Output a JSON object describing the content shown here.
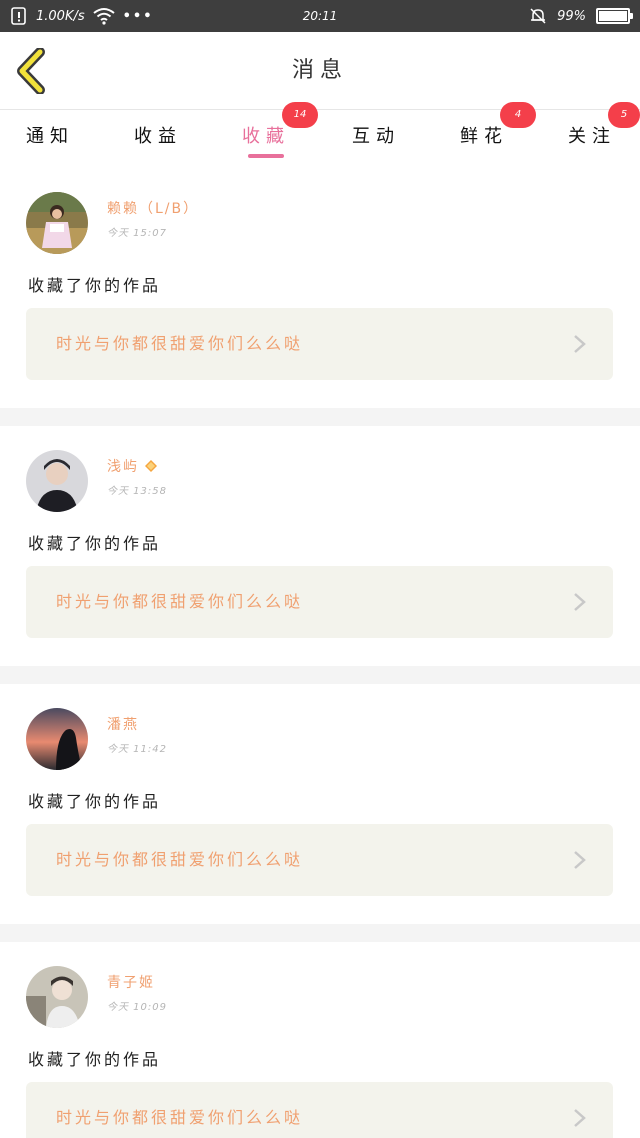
{
  "status_bar": {
    "speed": "1.00K/s",
    "time": "20:11",
    "battery_text": "99%",
    "battery_level": 0.99
  },
  "header": {
    "title": "消息"
  },
  "tabs": [
    {
      "label": "通知",
      "badge": null,
      "active": false
    },
    {
      "label": "收益",
      "badge": null,
      "active": false
    },
    {
      "label": "收藏",
      "badge": "14",
      "active": true
    },
    {
      "label": "互动",
      "badge": null,
      "active": false
    },
    {
      "label": "鲜花",
      "badge": "4",
      "active": false
    },
    {
      "label": "关注",
      "badge": "5",
      "active": false
    }
  ],
  "messages": [
    {
      "user": "赖赖（L/B）",
      "time": "今天 15:07",
      "action": "收藏了你的作品",
      "work": "时光与你都很甜爱你们么么哒",
      "verified": false
    },
    {
      "user": "浅屿",
      "time": "今天 13:58",
      "action": "收藏了你的作品",
      "work": "时光与你都很甜爱你们么么哒",
      "verified": true
    },
    {
      "user": "潘燕",
      "time": "今天 11:42",
      "action": "收藏了你的作品",
      "work": "时光与你都很甜爱你们么么哒",
      "verified": false
    },
    {
      "user": "青子姬",
      "time": "今天 10:09",
      "action": "收藏了你的作品",
      "work": "时光与你都很甜爱你们么么哒",
      "verified": false
    }
  ],
  "colors": {
    "accent_pink": "#e8709b",
    "badge_red": "#f43f4a",
    "name_orange": "#f0a070",
    "back_yellow": "#f2e23a"
  }
}
